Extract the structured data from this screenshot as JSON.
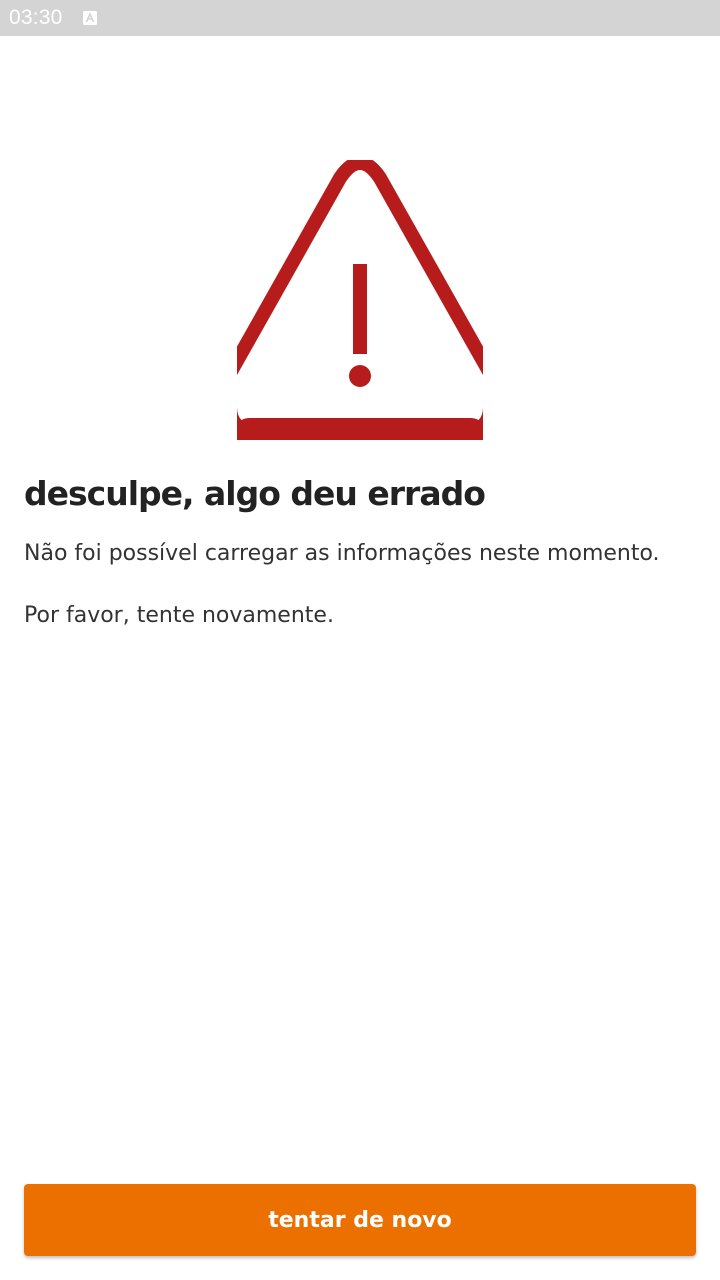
{
  "status_bar": {
    "time": "03:30",
    "notification_icon": "a-box-icon"
  },
  "error": {
    "icon": "warning-triangle-icon",
    "icon_color": "#b71c1c",
    "title": "desculpe, algo deu errado",
    "message_line1": "Não foi possível carregar as informações neste momento.",
    "message_line2": "Por favor, tente novamente."
  },
  "actions": {
    "retry_label": "tentar de novo",
    "retry_color": "#ec7000"
  }
}
